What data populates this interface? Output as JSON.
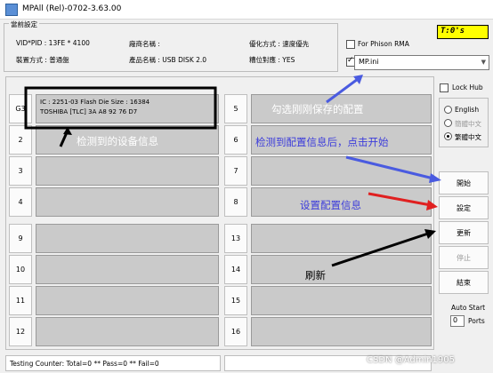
{
  "window": {
    "title": "MPAll (Rel)-0702-3.63.00"
  },
  "settings": {
    "legend": "當前設定",
    "vid_pid": "VID*PID : 13FE * 4100",
    "product_category": "裝置方式 : 普通盤",
    "maker_name": "廠商名稱 :",
    "product_name": "產品名稱 : USB DISK 2.0",
    "optimize": "優化方式 : 速度優先",
    "check_pattern": "糟位對應 : YES"
  },
  "toc": "T:0's",
  "rma": {
    "label": "For Phison RMA"
  },
  "ini": {
    "value": "MP.ini"
  },
  "lockhub": {
    "label": "Lock Hub"
  },
  "language": {
    "options": [
      "English",
      "簡體中文",
      "繁體中文"
    ],
    "selected": "繁體中文"
  },
  "ports_left": [
    {
      "label": "G3",
      "line1": "IC : 2251-03  Flash Die Size : 16384",
      "line2": "TOSHIBA [TLC] 3A A8 92 76 D7"
    },
    {
      "label": "2",
      "line1": "",
      "line2": ""
    },
    {
      "label": "3",
      "line1": "",
      "line2": ""
    },
    {
      "label": "4",
      "line1": "",
      "line2": ""
    },
    {
      "label": "9",
      "line1": "",
      "line2": ""
    },
    {
      "label": "10",
      "line1": "",
      "line2": ""
    },
    {
      "label": "11",
      "line1": "",
      "line2": ""
    },
    {
      "label": "12",
      "line1": "",
      "line2": ""
    }
  ],
  "ports_right": [
    "5",
    "6",
    "7",
    "8",
    "13",
    "14",
    "15",
    "16"
  ],
  "buttons": {
    "start": "開始",
    "setting": "設定",
    "update": "更新",
    "stop": "停止",
    "exit": "結束"
  },
  "autostart": {
    "label": "Auto Start",
    "value": "0",
    "suffix": "Ports"
  },
  "status": {
    "counter": "Testing Counter: Total=0 ** Pass=0 ** Fail=0"
  },
  "annotations": {
    "detected": "检测到的设备信息",
    "check_saved": "勾选刚刚保存的配置",
    "start_hint": "检测到配置信息后，点击开始",
    "setting_hint": "设置配置信息",
    "refresh": "刷新"
  },
  "watermark": "CSDN @Admin1905"
}
